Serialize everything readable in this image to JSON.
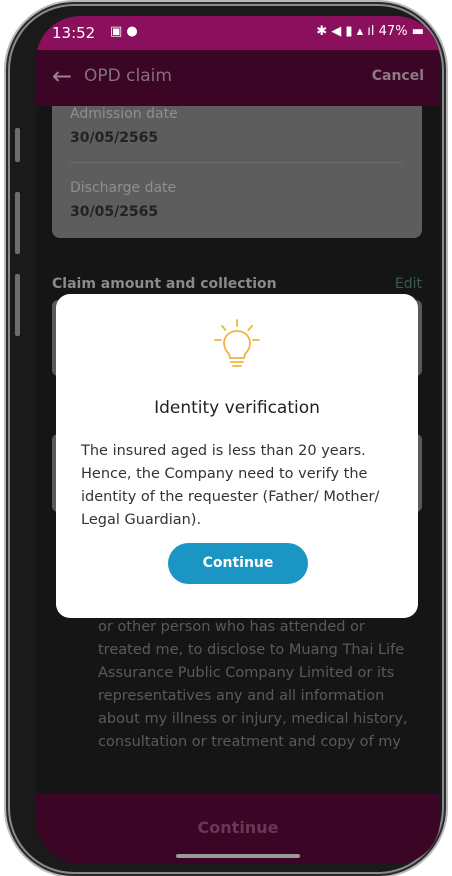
{
  "status_bar": {
    "time": "13:52",
    "indicators": "✶ ✖ ▙ ▲ .∣",
    "battery": "47%"
  },
  "app_bar": {
    "title": "OPD claim",
    "cancel_label": "Cancel"
  },
  "dates": {
    "admission_label": "Admission date",
    "admission_value": "30/05/2565",
    "discharge_label": "Discharge date",
    "discharge_value": "30/05/2565"
  },
  "claim_section": {
    "title": "Claim amount and collection",
    "edit_label": "Edit"
  },
  "consent_text": "or other person who has attended or treated me, to disclose to Muang Thai Life Assurance Public Company Limited or its representatives any and all information about my illness or injury, medical history, consultation or treatment and copy of my",
  "bottom": {
    "continue_label": "Continue"
  },
  "modal": {
    "title": "Identity verification",
    "message": "The insured aged is less than 20 years. Hence, the Company need to verify the identity of the requester (Father/ Mother/ Legal Guardian).",
    "button_label": "Continue"
  },
  "colors": {
    "brand": "#8a0f5d",
    "button": "#1b95c3",
    "icon_accent": "#f2b33d"
  }
}
